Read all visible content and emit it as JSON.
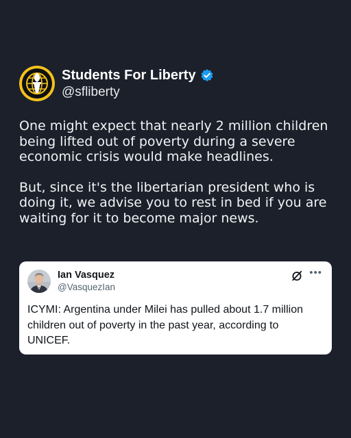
{
  "post": {
    "author": {
      "display_name": "Students For Liberty",
      "handle": "@sfliberty",
      "verified": true,
      "avatar_icon": "torch-globe-logo-icon",
      "avatar_colors": {
        "ring": "#f2c21b",
        "inner": "#101010"
      }
    },
    "paragraphs": [
      "One might expect that nearly 2 million children being lifted out of poverty during a severe economic crisis would make headlines.",
      "But, since it's the libertarian president who is doing it, we advise you to rest in bed if you are waiting for it to become major news."
    ]
  },
  "quoted_post": {
    "author": {
      "display_name": "Ian Vasquez",
      "handle": "@VasquezIan",
      "avatar_icon": "profile-photo-avatar"
    },
    "text": "ICYMI: Argentina under Milei has pulled about 1.7 million children out of poverty in the past year, according to UNICEF.",
    "icons": [
      "x-logo-icon",
      "more-options-icon"
    ]
  },
  "theme": {
    "background": "#1c202b",
    "verified_badge": "#1d9bf0",
    "card_background": "#ffffff"
  }
}
